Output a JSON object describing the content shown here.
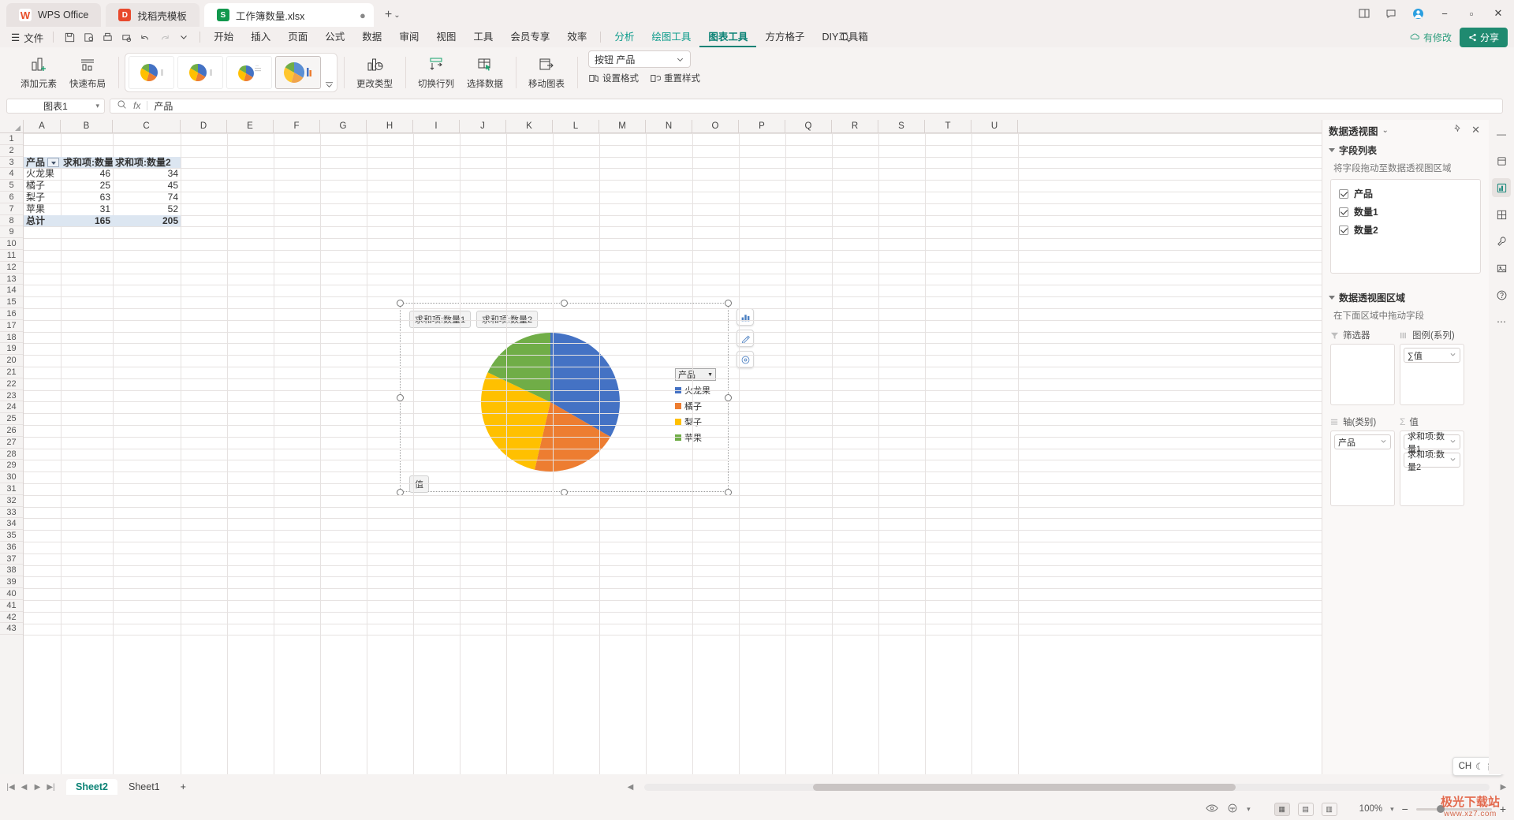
{
  "titlebar": {
    "tabs": [
      {
        "label": "WPS Office",
        "icon": "wps-logo-icon"
      },
      {
        "label": "找稻壳模板",
        "icon": "daoke-icon"
      },
      {
        "label": "工作簿数量.xlsx",
        "icon": "xlsx-file-icon"
      }
    ],
    "new_tab": "+",
    "new_tab_caret": "⌄",
    "window_buttons": [
      "▭",
      "⬚",
      "◯",
      "—",
      "⬜",
      "✕"
    ]
  },
  "menubar": {
    "file_label": "文件",
    "hamburger": "☰",
    "quick_access": [
      "save-icon",
      "save-as-icon",
      "print-icon",
      "print-preview-icon",
      "undo-icon",
      "redo-icon",
      "customize-caret-icon"
    ],
    "tabs": [
      {
        "label": "开始",
        "style": "normal"
      },
      {
        "label": "插入",
        "style": "normal"
      },
      {
        "label": "页面",
        "style": "normal"
      },
      {
        "label": "公式",
        "style": "normal"
      },
      {
        "label": "数据",
        "style": "normal"
      },
      {
        "label": "审阅",
        "style": "normal"
      },
      {
        "label": "视图",
        "style": "normal"
      },
      {
        "label": "工具",
        "style": "normal"
      },
      {
        "label": "会员专享",
        "style": "normal"
      },
      {
        "label": "效率",
        "style": "normal"
      },
      {
        "label": "分析",
        "style": "teal"
      },
      {
        "label": "绘图工具",
        "style": "teal"
      },
      {
        "label": "图表工具",
        "style": "active"
      },
      {
        "label": "方方格子",
        "style": "normal"
      },
      {
        "label": "DIY工具箱",
        "style": "normal"
      }
    ],
    "search_icon": "search-icon",
    "saved_status": "有修改",
    "share_label": "分享"
  },
  "ribbon": {
    "add_element": "添加元素",
    "quick_layout": "快速布局",
    "gallery_items": [
      "pie-style-1",
      "pie-style-2",
      "pie-style-3",
      "pie-style-4"
    ],
    "gallery_more": "更多",
    "change_type": "更改类型",
    "switch_row_col": "切换行列",
    "select_data": "选择数据",
    "move_chart": "移动图表",
    "element_select": "按钮 产品",
    "format_shape": "设置格式",
    "reset_style": "重置样式"
  },
  "formulabar": {
    "name_box": "图表1",
    "zoom_icon": "search-zoom-icon",
    "fx_label": "fx",
    "formula_value": "产品"
  },
  "sheet": {
    "columns": [
      "A",
      "B",
      "C",
      "D",
      "E",
      "F",
      "G",
      "H",
      "I",
      "J",
      "K",
      "L",
      "M",
      "N",
      "O",
      "P",
      "Q",
      "R",
      "S",
      "T",
      "U"
    ],
    "first_row": 1,
    "last_row": 43,
    "pivot": {
      "header_row": 3,
      "headers": [
        "产品",
        "求和项:数量1",
        "求和项:数量2"
      ],
      "filter_icon": "filter-dropdown-icon",
      "rows": [
        {
          "name": "火龙果",
          "v1": "46",
          "v2": "34"
        },
        {
          "name": "橘子",
          "v1": "25",
          "v2": "45"
        },
        {
          "name": "梨子",
          "v1": "63",
          "v2": "74"
        },
        {
          "name": "苹果",
          "v1": "31",
          "v2": "52"
        }
      ],
      "total": {
        "name": "总计",
        "v1": "165",
        "v2": "205"
      }
    }
  },
  "chart": {
    "field_buttons": [
      "求和项:数量1",
      "求和项:数量2"
    ],
    "value_button": "值",
    "legend_title": "产品",
    "side_tools": [
      "chart-elements-icon",
      "chart-style-icon",
      "chart-filter-icon"
    ],
    "handles": 8
  },
  "chart_data": {
    "type": "pie",
    "title": "",
    "categories": [
      "火龙果",
      "橘子",
      "梨子",
      "苹果"
    ],
    "values": [
      46,
      25,
      63,
      31
    ],
    "colors": [
      "#4472c4",
      "#ed7d31",
      "#ffc000",
      "#70ad47"
    ],
    "legend_title": "产品",
    "legend_position": "right",
    "series_name": "求和项:数量1",
    "total": 165,
    "secondary_series": {
      "name": "求和项:数量2",
      "values": [
        34,
        45,
        74,
        52
      ],
      "total": 205
    }
  },
  "pane": {
    "title": "数据透视图",
    "title_caret": "⌄",
    "pin_icon": "pin-icon",
    "close_icon": "close-icon",
    "field_section": {
      "label": "字段列表",
      "hint": "将字段拖动至数据透视图区域",
      "fields": [
        "产品",
        "数量1",
        "数量2"
      ]
    },
    "area_section": {
      "label": "数据透视图区域",
      "hint": "在下面区域中拖动字段",
      "filter_label": "筛选器",
      "filter_items": [],
      "legend_label": "图例(系列)",
      "legend_items": [
        "∑值"
      ],
      "axis_label": "轴(类别)",
      "axis_items": [
        "产品"
      ],
      "values_label": "值",
      "values_items": [
        "求和项:数量1",
        "求和项:数量2"
      ]
    }
  },
  "rail": [
    "minimize-pane-icon",
    "properties-icon",
    "chart-pane-icon",
    "cell-pane-icon",
    "tools-icon",
    "picture-pane-icon",
    "help-icon",
    "more-icon"
  ],
  "sheettabs": {
    "nav": [
      "⏮",
      "◀",
      "▶",
      "⏭"
    ],
    "tabs": [
      {
        "label": "Sheet2",
        "active": true
      },
      {
        "label": "Sheet1",
        "active": false
      }
    ],
    "add": "+"
  },
  "statusbar": {
    "view_icons": [
      "eye-icon",
      "accessibility-icon"
    ],
    "layout_icons": [
      "normal-view-icon",
      "page-layout-icon",
      "page-break-icon"
    ],
    "zoom": "100%",
    "zoom_minus": "−",
    "zoom_plus": "+"
  },
  "ime": {
    "lang": "CH",
    "mode": "简",
    "moon": "☾"
  },
  "watermark": {
    "title": "极光下载站",
    "url": "www.xz7.com"
  }
}
